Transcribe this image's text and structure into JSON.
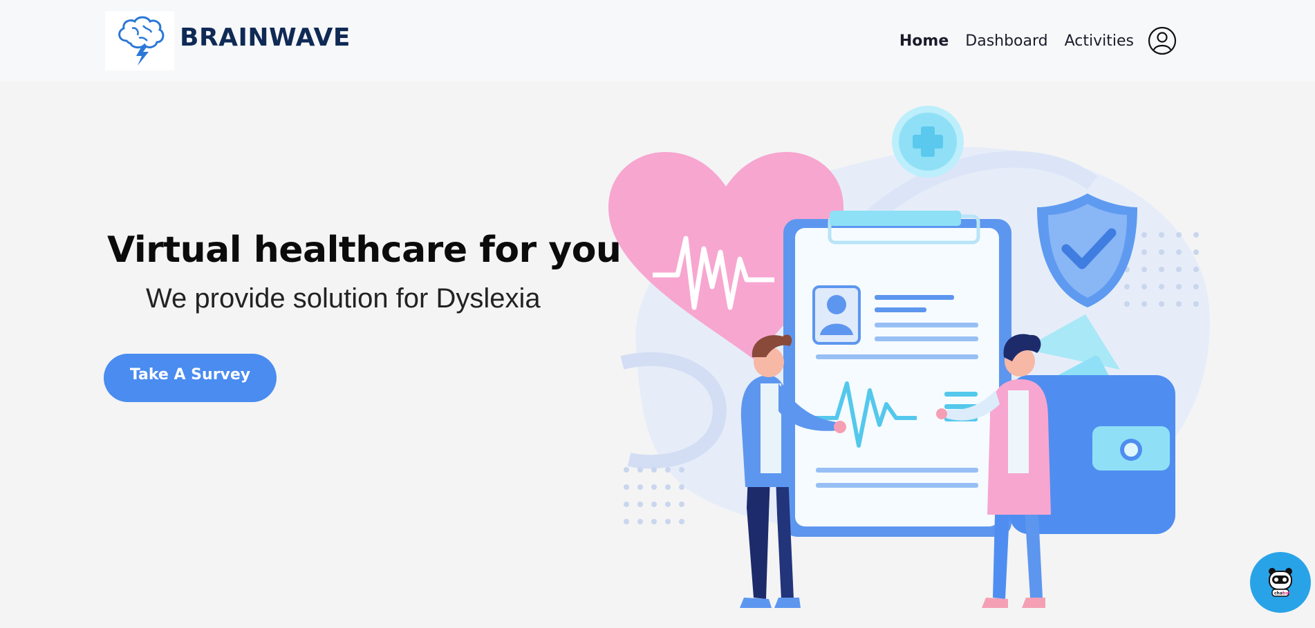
{
  "header": {
    "brand": "BRAINWAVE",
    "logo_icon": "brain-lightning-icon",
    "nav": [
      {
        "label": "Home",
        "active": true
      },
      {
        "label": "Dashboard",
        "active": false
      },
      {
        "label": "Activities",
        "active": false
      }
    ],
    "user_icon": "user-circle-icon"
  },
  "hero": {
    "title": "Virtual healthcare for you",
    "subtitle": "We provide solution for Dyslexia",
    "cta_label": "Take A Survey"
  },
  "chatbot": {
    "icon": "robot-icon",
    "label_a": "chat",
    "label_b": "bot"
  },
  "colors": {
    "accent": "#4a8cf0",
    "brand": "#0f2a55",
    "chatbot": "#29a3e8",
    "heart": "#f7a6d0"
  }
}
